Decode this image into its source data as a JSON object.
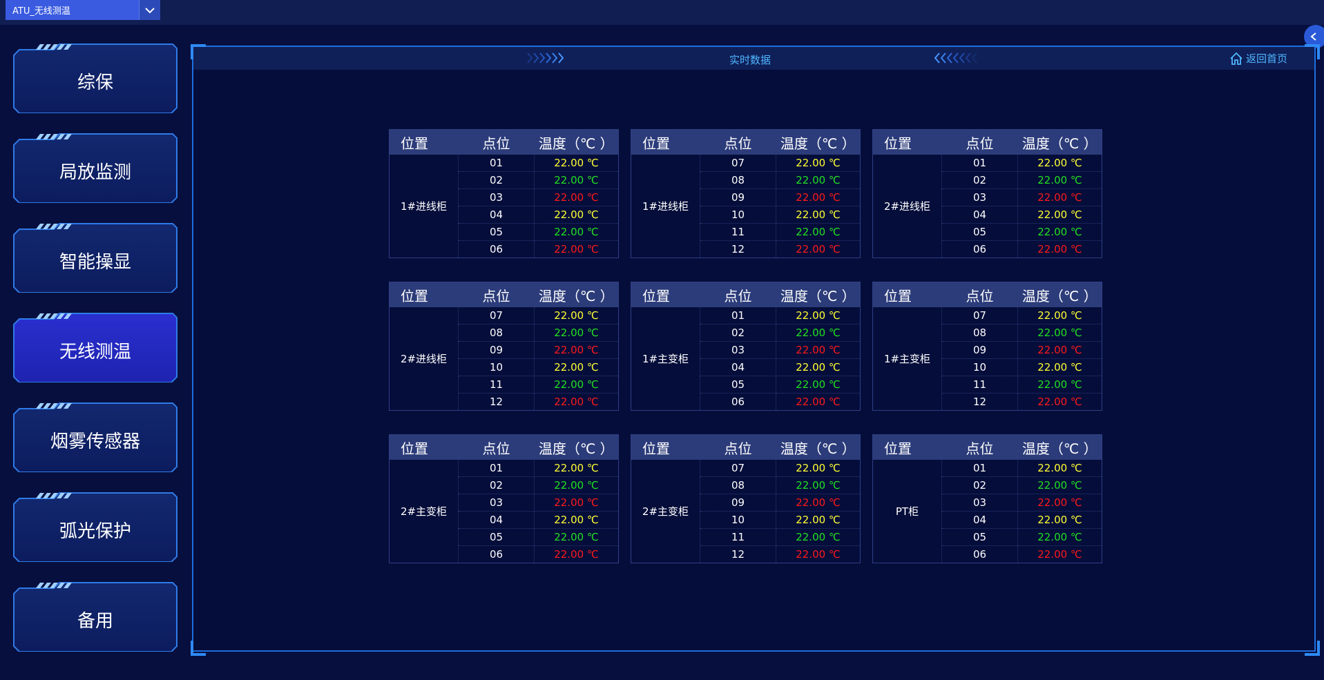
{
  "window": {
    "selector_value": "ATU_无线测温"
  },
  "nav": {
    "items": [
      {
        "label": "综保",
        "active": false
      },
      {
        "label": "局放监测",
        "active": false
      },
      {
        "label": "智能操显",
        "active": false
      },
      {
        "label": "无线测温",
        "active": true
      },
      {
        "label": "烟雾传感器",
        "active": false
      },
      {
        "label": "弧光保护",
        "active": false
      },
      {
        "label": "备用",
        "active": false
      }
    ]
  },
  "panel": {
    "title": "实时数据",
    "home_label": "返回首页"
  },
  "table_headers": {
    "position": "位置",
    "point": "点位",
    "temp": "温度（℃ ）"
  },
  "colors": {
    "yellow": "#ffff33",
    "green": "#22e022",
    "red": "#ff1a1a",
    "accent": "#1e6fe0"
  },
  "tables": [
    {
      "location": "1#进线柜",
      "rows": [
        {
          "point": "01",
          "temp": "22.00 ℃",
          "color": "yellow"
        },
        {
          "point": "02",
          "temp": "22.00 ℃",
          "color": "green"
        },
        {
          "point": "03",
          "temp": "22.00 ℃",
          "color": "red"
        },
        {
          "point": "04",
          "temp": "22.00 ℃",
          "color": "yellow"
        },
        {
          "point": "05",
          "temp": "22.00 ℃",
          "color": "green"
        },
        {
          "point": "06",
          "temp": "22.00 ℃",
          "color": "red"
        }
      ]
    },
    {
      "location": "1#进线柜",
      "rows": [
        {
          "point": "07",
          "temp": "22.00 ℃",
          "color": "yellow"
        },
        {
          "point": "08",
          "temp": "22.00 ℃",
          "color": "green"
        },
        {
          "point": "09",
          "temp": "22.00 ℃",
          "color": "red"
        },
        {
          "point": "10",
          "temp": "22.00 ℃",
          "color": "yellow"
        },
        {
          "point": "11",
          "temp": "22.00 ℃",
          "color": "green"
        },
        {
          "point": "12",
          "temp": "22.00 ℃",
          "color": "red"
        }
      ]
    },
    {
      "location": "2#进线柜",
      "rows": [
        {
          "point": "01",
          "temp": "22.00 ℃",
          "color": "yellow"
        },
        {
          "point": "02",
          "temp": "22.00 ℃",
          "color": "green"
        },
        {
          "point": "03",
          "temp": "22.00 ℃",
          "color": "red"
        },
        {
          "point": "04",
          "temp": "22.00 ℃",
          "color": "yellow"
        },
        {
          "point": "05",
          "temp": "22.00 ℃",
          "color": "green"
        },
        {
          "point": "06",
          "temp": "22.00 ℃",
          "color": "red"
        }
      ]
    },
    {
      "location": "2#进线柜",
      "rows": [
        {
          "point": "07",
          "temp": "22.00 ℃",
          "color": "yellow"
        },
        {
          "point": "08",
          "temp": "22.00 ℃",
          "color": "green"
        },
        {
          "point": "09",
          "temp": "22.00 ℃",
          "color": "red"
        },
        {
          "point": "10",
          "temp": "22.00 ℃",
          "color": "yellow"
        },
        {
          "point": "11",
          "temp": "22.00 ℃",
          "color": "green"
        },
        {
          "point": "12",
          "temp": "22.00 ℃",
          "color": "red"
        }
      ]
    },
    {
      "location": "1#主变柜",
      "rows": [
        {
          "point": "01",
          "temp": "22.00 ℃",
          "color": "yellow"
        },
        {
          "point": "02",
          "temp": "22.00 ℃",
          "color": "green"
        },
        {
          "point": "03",
          "temp": "22.00 ℃",
          "color": "red"
        },
        {
          "point": "04",
          "temp": "22.00 ℃",
          "color": "yellow"
        },
        {
          "point": "05",
          "temp": "22.00 ℃",
          "color": "green"
        },
        {
          "point": "06",
          "temp": "22.00 ℃",
          "color": "red"
        }
      ]
    },
    {
      "location": "1#主变柜",
      "rows": [
        {
          "point": "07",
          "temp": "22.00 ℃",
          "color": "yellow"
        },
        {
          "point": "08",
          "temp": "22.00 ℃",
          "color": "green"
        },
        {
          "point": "09",
          "temp": "22.00 ℃",
          "color": "red"
        },
        {
          "point": "10",
          "temp": "22.00 ℃",
          "color": "yellow"
        },
        {
          "point": "11",
          "temp": "22.00 ℃",
          "color": "green"
        },
        {
          "point": "12",
          "temp": "22.00 ℃",
          "color": "red"
        }
      ]
    },
    {
      "location": "2#主变柜",
      "rows": [
        {
          "point": "01",
          "temp": "22.00 ℃",
          "color": "yellow"
        },
        {
          "point": "02",
          "temp": "22.00 ℃",
          "color": "green"
        },
        {
          "point": "03",
          "temp": "22.00 ℃",
          "color": "red"
        },
        {
          "point": "04",
          "temp": "22.00 ℃",
          "color": "yellow"
        },
        {
          "point": "05",
          "temp": "22.00 ℃",
          "color": "green"
        },
        {
          "point": "06",
          "temp": "22.00 ℃",
          "color": "red"
        }
      ]
    },
    {
      "location": "2#主变柜",
      "rows": [
        {
          "point": "07",
          "temp": "22.00 ℃",
          "color": "yellow"
        },
        {
          "point": "08",
          "temp": "22.00 ℃",
          "color": "green"
        },
        {
          "point": "09",
          "temp": "22.00 ℃",
          "color": "red"
        },
        {
          "point": "10",
          "temp": "22.00 ℃",
          "color": "yellow"
        },
        {
          "point": "11",
          "temp": "22.00 ℃",
          "color": "green"
        },
        {
          "point": "12",
          "temp": "22.00 ℃",
          "color": "red"
        }
      ]
    },
    {
      "location": "PT柜",
      "rows": [
        {
          "point": "01",
          "temp": "22.00 ℃",
          "color": "yellow"
        },
        {
          "point": "02",
          "temp": "22.00 ℃",
          "color": "green"
        },
        {
          "point": "03",
          "temp": "22.00 ℃",
          "color": "red"
        },
        {
          "point": "04",
          "temp": "22.00 ℃",
          "color": "yellow"
        },
        {
          "point": "05",
          "temp": "22.00 ℃",
          "color": "green"
        },
        {
          "point": "06",
          "temp": "22.00 ℃",
          "color": "red"
        }
      ]
    }
  ]
}
